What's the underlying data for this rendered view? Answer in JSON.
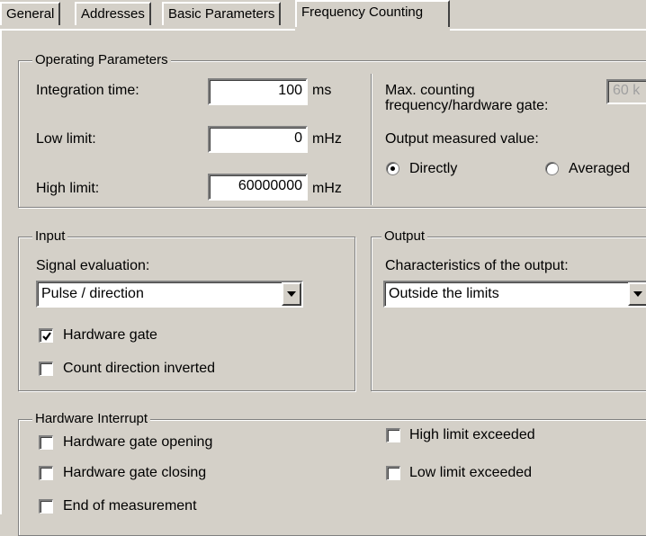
{
  "tabs": [
    "General",
    "Addresses",
    "Basic Parameters",
    "Frequency Counting"
  ],
  "operating": {
    "title": "Operating Parameters",
    "integration_label": "Integration time:",
    "integration_value": "100",
    "integration_unit": "ms",
    "low_label": "Low limit:",
    "low_value": "0",
    "low_unit": "mHz",
    "high_label": "High limit:",
    "high_value": "60000000",
    "high_unit": "mHz",
    "max_freq_label_line1": "Max. counting",
    "max_freq_label_line2": "frequency/hardware gate:",
    "max_freq_value": "60 k",
    "output_measured_label": "Output measured value:",
    "radio_directly": "Directly",
    "radio_averaged": "Averaged",
    "selected_radio": "Directly"
  },
  "input": {
    "title": "Input",
    "signal_label": "Signal evaluation:",
    "signal_value": "Pulse / direction",
    "hardware_gate_label": "Hardware gate",
    "hardware_gate_checked": true,
    "count_dir_label": "Count direction inverted",
    "count_dir_checked": false
  },
  "output": {
    "title": "Output",
    "characteristics_label": "Characteristics of the output:",
    "characteristics_value": "Outside the limits"
  },
  "interrupt": {
    "title": "Hardware Interrupt",
    "gate_opening": "Hardware gate opening",
    "gate_closing": "Hardware gate closing",
    "end_measurement": "End of measurement",
    "high_exceeded": "High limit exceeded",
    "low_exceeded": "Low limit exceeded"
  }
}
